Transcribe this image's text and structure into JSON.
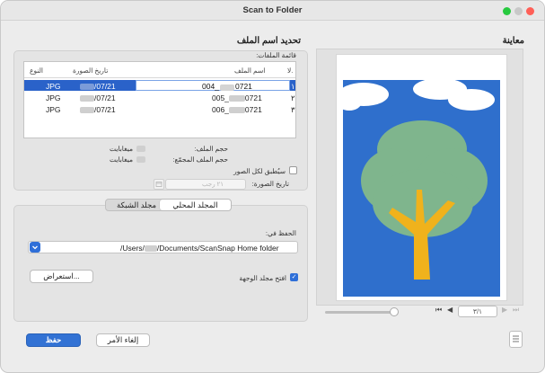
{
  "window": {
    "title": "Scan to Folder"
  },
  "preview": {
    "header": "معاينة",
    "page_indicator": "٣/١"
  },
  "filename_section": {
    "header": "تحديد اسم الملف",
    "list_label": "قائمة الملفات:",
    "columns": {
      "no": "لا.",
      "filename": "اسم الملف",
      "scan_date": "تاريخ الصورة",
      "type": "النوع"
    },
    "rows": [
      {
        "no": "١",
        "filename_prefix": "004_",
        "filename_suffix": "0721",
        "date_suffix": "/07/21",
        "type": "JPG"
      },
      {
        "no": "٢",
        "filename_prefix": "005_",
        "filename_suffix": "0721",
        "date_suffix": "/07/21",
        "type": "JPG"
      },
      {
        "no": "٣",
        "filename_prefix": "006_",
        "filename_suffix": "0721",
        "date_suffix": "/07/21",
        "type": "JPG"
      }
    ],
    "file_size_label": "حجم الملف:",
    "file_size_unit": "ميغابايت",
    "total_size_label": "حجم الملف المجمّع:",
    "total_size_unit": "ميغابايت",
    "apply_all_label": "سيُطبق لكل الصور",
    "image_date_label": "تاريخ الصورة:",
    "date_placeholder": "٢١ رجب"
  },
  "destination": {
    "tab_local": "المجلد المحلي",
    "tab_network": "مجلد الشبكة",
    "save_in_label": "الحفظ في:",
    "path_prefix": "/Users/",
    "path_suffix": "/Documents/ScanSnap Home folder",
    "browse_label": "استعراض...",
    "open_folder_label": "افتح مجلد الوجهة"
  },
  "footer": {
    "save_label": "حفظ",
    "cancel_label": "إلغاء الأمر"
  },
  "colors": {
    "accent": "#3272d4",
    "selection": "#2a62c9",
    "sky": "#2f6fcc",
    "trunk": "#f0b21c",
    "foliage": "#7fb58d"
  }
}
